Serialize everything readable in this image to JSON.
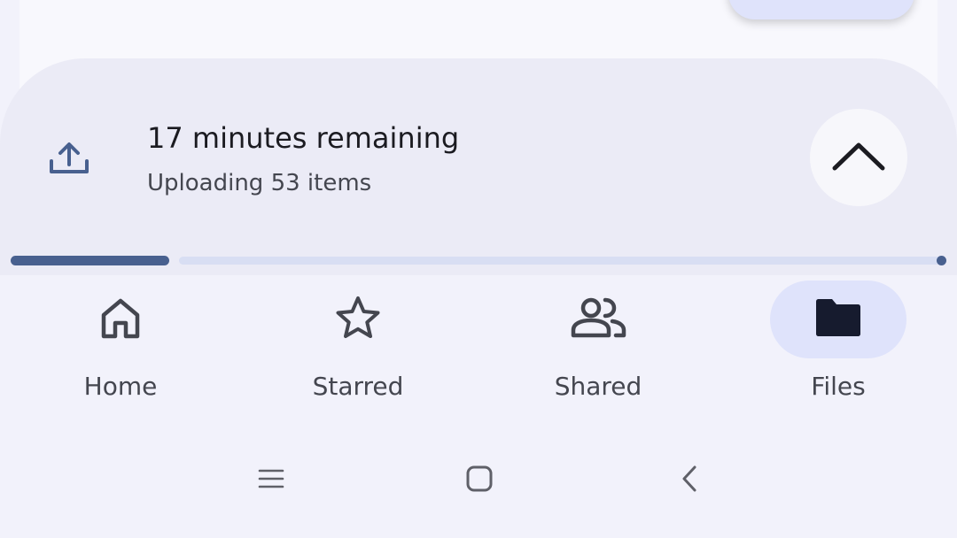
{
  "upload": {
    "title": "17 minutes remaining",
    "subtitle": "Uploading 53 items",
    "progress_fraction": 0.17,
    "icon": "upload-icon",
    "expand_icon": "chevron-up-icon"
  },
  "nav": {
    "items": [
      {
        "label": "Home",
        "icon": "home-icon",
        "active": false
      },
      {
        "label": "Starred",
        "icon": "star-icon",
        "active": false
      },
      {
        "label": "Shared",
        "icon": "people-icon",
        "active": false
      },
      {
        "label": "Files",
        "icon": "folder-icon",
        "active": true
      }
    ]
  },
  "system_nav": {
    "buttons": [
      "recent-apps-icon",
      "home-circle-icon",
      "back-icon"
    ]
  },
  "colors": {
    "accent": "#48608f",
    "active_pill": "#dfe3fb",
    "sheet": "#ebebf6",
    "background": "#f2f2fb"
  }
}
